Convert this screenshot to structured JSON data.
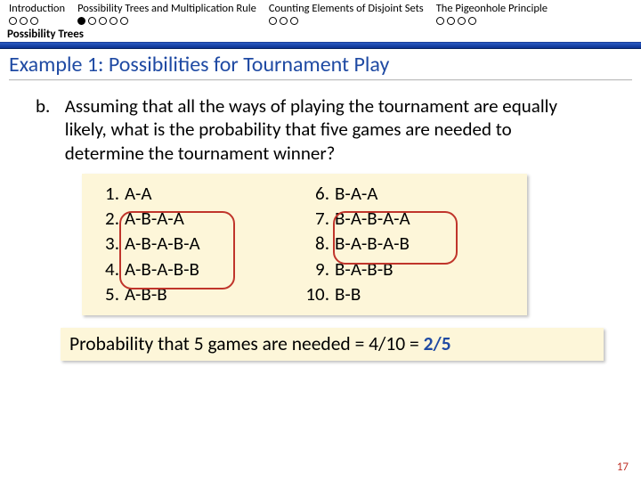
{
  "nav": {
    "items": [
      {
        "label": "Introduction",
        "total": 3,
        "filled": 0
      },
      {
        "label": "Possibility Trees and Multiplication Rule",
        "total": 5,
        "filled": 1
      },
      {
        "label": "Counting Elements of Disjoint Sets",
        "total": 3,
        "filled": 0
      },
      {
        "label": "The Pigeonhole Principle",
        "total": 4,
        "filled": 0
      }
    ]
  },
  "subhead": "Possibility Trees",
  "title": "Example 1: Possibilities for Tournament Play",
  "question": {
    "label": "b.",
    "text": "Assuming that all the ways of playing the tournament are equally likely, what is the probability that five games are needed to determine the tournament winner?"
  },
  "answers": {
    "left": [
      {
        "n": "1.",
        "v": "A-A"
      },
      {
        "n": "2.",
        "v": "A-B-A-A"
      },
      {
        "n": "3.",
        "v": "A-B-A-B-A"
      },
      {
        "n": "4.",
        "v": "A-B-A-B-B"
      },
      {
        "n": "5.",
        "v": "A-B-B"
      }
    ],
    "right": [
      {
        "n": "6.",
        "v": "B-A-A"
      },
      {
        "n": "7.",
        "v": "B-A-B-A-A"
      },
      {
        "n": "8.",
        "v": "B-A-B-A-B"
      },
      {
        "n": "9.",
        "v": "B-A-B-B"
      },
      {
        "n": "10.",
        "v": "B-B"
      }
    ]
  },
  "probability": {
    "prefix": "Probability that 5 games are needed = 4/10 = ",
    "result": "2/5"
  },
  "pageno": "17",
  "chart_data": {
    "type": "table",
    "title": "Tournament outcome sequences and probability of needing 5 games",
    "outcomes": [
      "A-A",
      "A-B-A-A",
      "A-B-A-B-A",
      "A-B-A-B-B",
      "A-B-B",
      "B-A-A",
      "B-A-B-A-A",
      "B-A-B-A-B",
      "B-A-B-B",
      "B-B"
    ],
    "five_game_outcomes": [
      "A-B-A-B-A",
      "A-B-A-B-B",
      "B-A-B-A-A",
      "B-A-B-A-B"
    ],
    "favorable": 4,
    "total": 10,
    "probability": 0.4
  }
}
